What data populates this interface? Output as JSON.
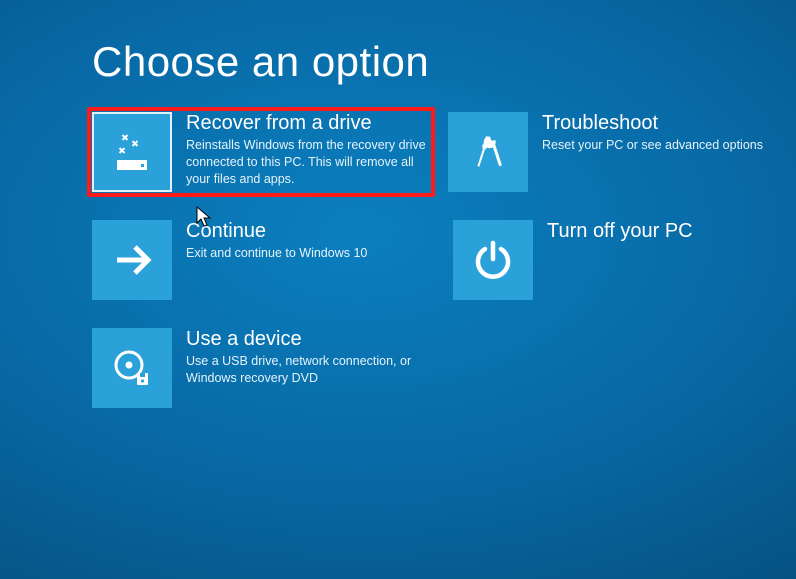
{
  "title": "Choose an option",
  "options": {
    "recover": {
      "title": "Recover from a drive",
      "desc": "Reinstalls Windows from the recovery drive connected to this PC. This will remove all your files and apps."
    },
    "troubleshoot": {
      "title": "Troubleshoot",
      "desc": "Reset your PC or see advanced options"
    },
    "continue": {
      "title": "Continue",
      "desc": "Exit and continue to Windows 10"
    },
    "turnoff": {
      "title": "Turn off your PC",
      "desc": ""
    },
    "usedevice": {
      "title": "Use a device",
      "desc": "Use a USB drive, network connection, or Windows recovery DVD"
    }
  },
  "colors": {
    "tile": "#2aa2d9",
    "highlight": "#ff1a1a"
  }
}
